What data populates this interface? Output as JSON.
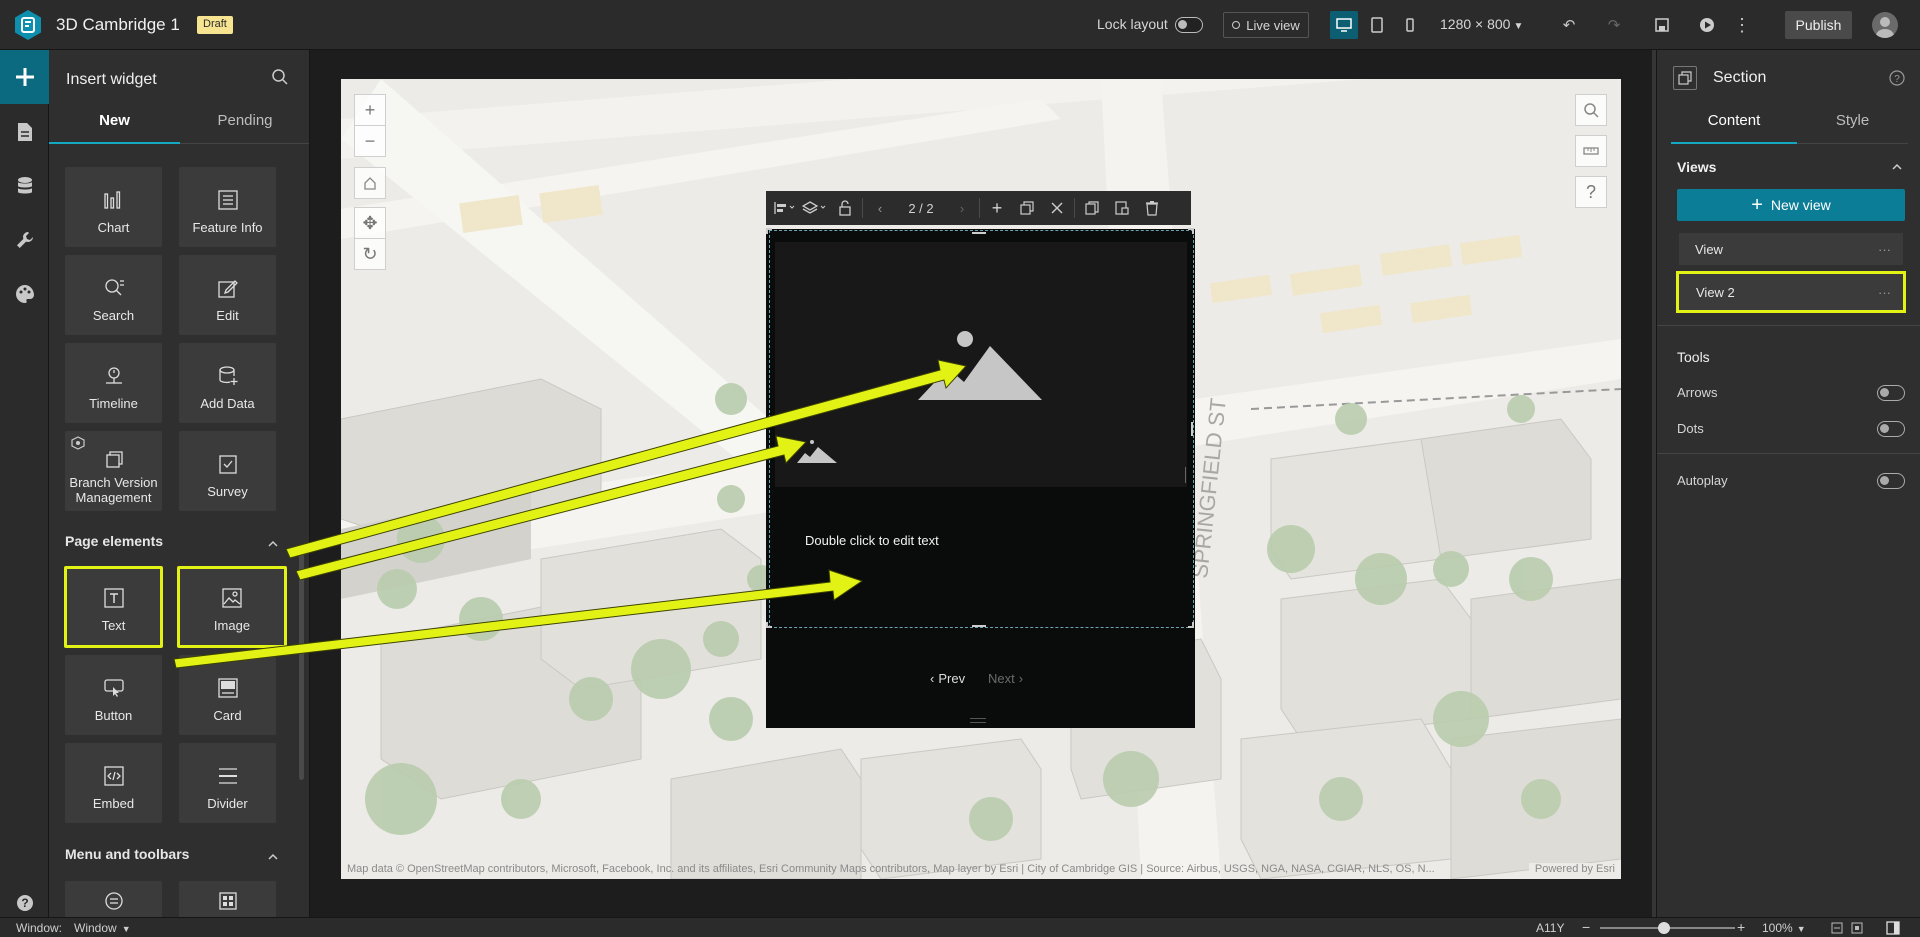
{
  "header": {
    "app_title": "3D Cambridge 1",
    "draft_badge": "Draft",
    "lock_layout_label": "Lock layout",
    "live_view_label": "Live view",
    "resolution": "1280 × 800",
    "publish_label": "Publish"
  },
  "widget_panel": {
    "title": "Insert widget",
    "tabs": [
      "New",
      "Pending"
    ],
    "tiles": [
      "Chart",
      "Feature Info",
      "Search",
      "Edit",
      "Timeline",
      "Add Data",
      "Branch Version Management",
      "Survey"
    ],
    "page_elements_label": "Page elements",
    "page_tiles": [
      "Text",
      "Image",
      "Button",
      "Card",
      "Embed",
      "Divider"
    ],
    "menu_toolbars_label": "Menu and toolbars"
  },
  "section_toolbar": {
    "page_indicator": "2 / 2"
  },
  "card": {
    "edit_text": "Double click to edit text",
    "prev_label": "Prev",
    "next_label": "Next"
  },
  "map": {
    "street_label": "SPRINGFIELD ST",
    "attribution": "Map data © OpenStreetMap contributors, Microsoft, Facebook, Inc. and its affiliates, Esri Community Maps contributors, Map layer by Esri | City of Cambridge GIS | Source: Airbus, USGS, NGA, NASA, CGIAR, NLS, OS, N...",
    "powered_by": "Powered by Esri"
  },
  "right_panel": {
    "title": "Section",
    "tabs": [
      "Content",
      "Style"
    ],
    "views_label": "Views",
    "new_view_label": "New view",
    "views": [
      "View",
      "View 2"
    ],
    "tools_label": "Tools",
    "arrows_label": "Arrows",
    "dots_label": "Dots",
    "autoplay_label": "Autoplay"
  },
  "statusbar": {
    "window_label": "Window:",
    "window_value": "Window",
    "a11y": "A11Y",
    "zoom": "100%"
  },
  "colors": {
    "accent": "#14a7c2",
    "highlight": "#e3f215",
    "button_primary": "#0c7d96"
  }
}
